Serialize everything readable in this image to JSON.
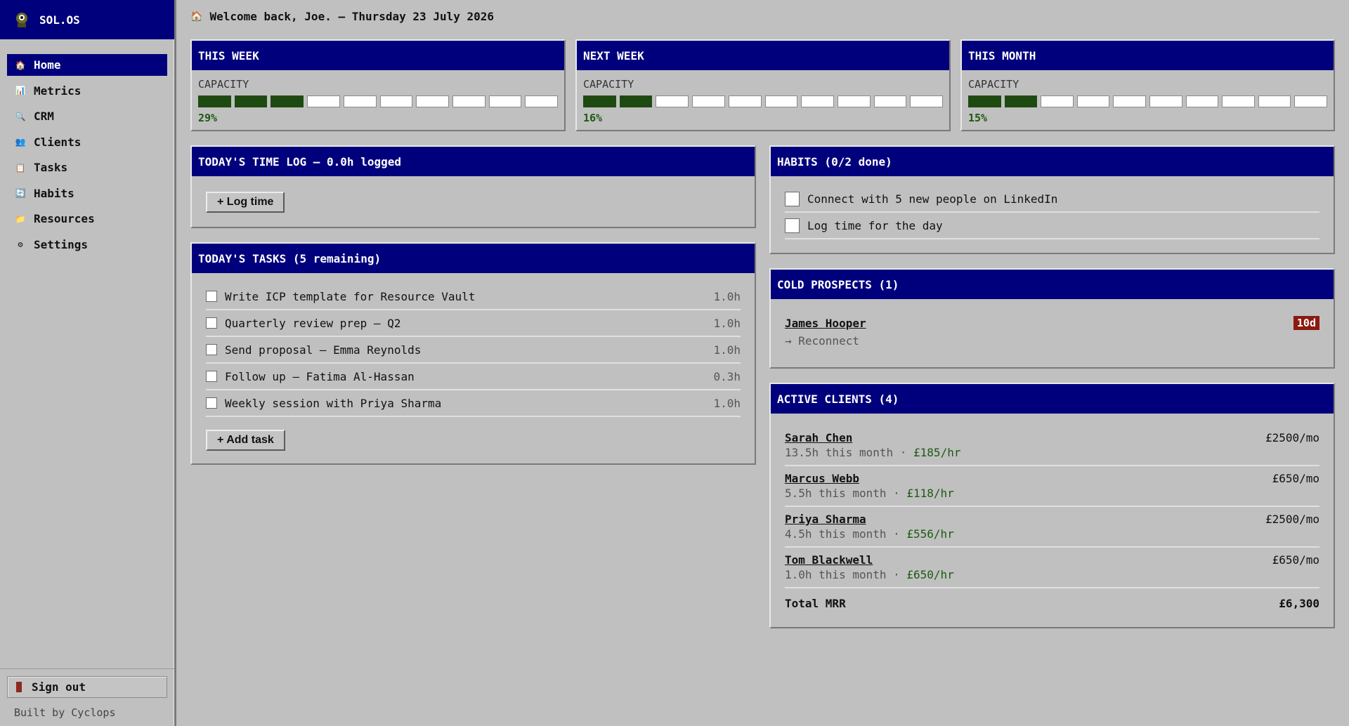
{
  "brand": {
    "name": "SOL.OS"
  },
  "nav": [
    {
      "label": "Home",
      "icon": "house-icon",
      "active": true
    },
    {
      "label": "Metrics",
      "icon": "bar-chart-icon"
    },
    {
      "label": "CRM",
      "icon": "magnifier-icon"
    },
    {
      "label": "Clients",
      "icon": "people-icon"
    },
    {
      "label": "Tasks",
      "icon": "notepad-icon"
    },
    {
      "label": "Habits",
      "icon": "refresh-icon"
    },
    {
      "label": "Resources",
      "icon": "folder-icon"
    },
    {
      "label": "Settings",
      "icon": "gear-icon"
    }
  ],
  "sidebar_footer": {
    "signout_label": "Sign out",
    "built_by": "Built by Cyclops"
  },
  "header": {
    "welcome": "Welcome back, Joe. — Thursday 23 July 2026"
  },
  "capacity": [
    {
      "title": "THIS WEEK",
      "label": "CAPACITY",
      "pct_text": "29%",
      "filled_segments": 3,
      "total_segments": 10
    },
    {
      "title": "NEXT WEEK",
      "label": "CAPACITY",
      "pct_text": "16%",
      "filled_segments": 2,
      "total_segments": 10
    },
    {
      "title": "THIS MONTH",
      "label": "CAPACITY",
      "pct_text": "15%",
      "filled_segments": 2,
      "total_segments": 10
    }
  ],
  "time_log": {
    "title": "TODAY'S TIME LOG — 0.0h logged",
    "button": "+ Log time"
  },
  "tasks": {
    "title": "TODAY'S TASKS (5 remaining)",
    "items": [
      {
        "label": "Write ICP template for Resource Vault",
        "hours": "1.0h"
      },
      {
        "label": "Quarterly review prep — Q2",
        "hours": "1.0h"
      },
      {
        "label": "Send proposal — Emma Reynolds",
        "hours": "1.0h"
      },
      {
        "label": "Follow up — Fatima Al-Hassan",
        "hours": "0.3h"
      },
      {
        "label": "Weekly session with Priya Sharma",
        "hours": "1.0h"
      }
    ],
    "button": "+ Add task"
  },
  "habits": {
    "title": "HABITS (0/2 done)",
    "items": [
      {
        "label": "Connect with 5 new people on LinkedIn"
      },
      {
        "label": "Log time for the day"
      }
    ]
  },
  "cold_prospects": {
    "title": "COLD PROSPECTS (1)",
    "items": [
      {
        "name": "James Hooper",
        "badge": "10d",
        "action": "→ Reconnect"
      }
    ]
  },
  "clients": {
    "title": "ACTIVE CLIENTS (4)",
    "items": [
      {
        "name": "Sarah Chen",
        "hours": "13.5h this month · ",
        "rate": "£185/hr",
        "mrr": "£2500/mo"
      },
      {
        "name": "Marcus Webb",
        "hours": "5.5h this month · ",
        "rate": "£118/hr",
        "mrr": "£650/mo"
      },
      {
        "name": "Priya Sharma",
        "hours": "4.5h this month · ",
        "rate": "£556/hr",
        "mrr": "£2500/mo"
      },
      {
        "name": "Tom Blackwell",
        "hours": "1.0h this month · ",
        "rate": "£650/hr",
        "mrr": "£650/mo"
      }
    ],
    "total_label": "Total MRR",
    "total_value": "£6,300"
  },
  "colors": {
    "header_blue": "#00007d",
    "capacity_fill": "#1e4a12",
    "badge_red": "#8b1a10"
  }
}
